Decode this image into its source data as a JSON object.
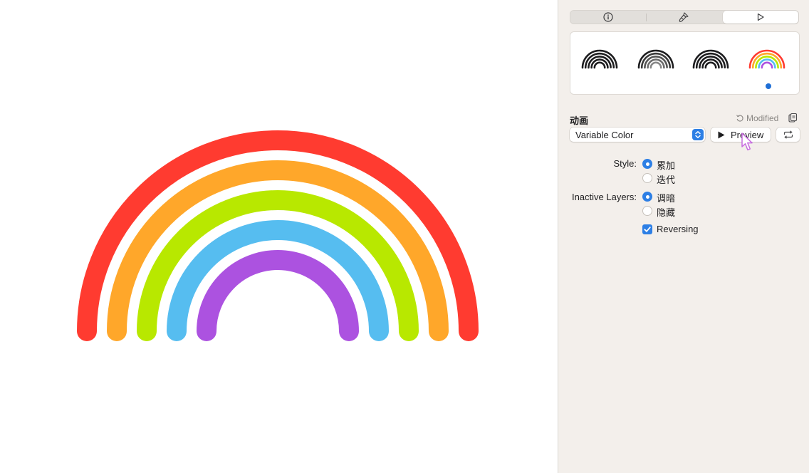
{
  "canvas": {
    "arc_colors": [
      "#ff3b30",
      "#ffa72a",
      "#b8e800",
      "#56bdf0",
      "#ac52e0"
    ]
  },
  "inspector": {
    "tabs": [
      {
        "icon": "info-icon"
      },
      {
        "icon": "paintbrush-icon"
      },
      {
        "icon": "play-icon",
        "selected": true
      }
    ],
    "gallery": {
      "thumbnails": [
        "monochrome-rainbow",
        "hierarchical-rainbow",
        "palette-rainbow",
        "multicolor-rainbow"
      ],
      "selected_index": 3
    },
    "animation": {
      "section_title": "动画",
      "modified_label": "Modified",
      "effect_value": "Variable Color",
      "preview_label": "Preview"
    },
    "style": {
      "label": "Style:",
      "options": [
        "累加",
        "迭代"
      ],
      "selected_index": 0
    },
    "inactive_layers": {
      "label": "Inactive Layers:",
      "options": [
        "调暗",
        "隐藏"
      ],
      "selected_index": 0
    },
    "reversing": {
      "label": "Reversing",
      "checked": true
    },
    "accent_color": "#2d7fe5"
  }
}
